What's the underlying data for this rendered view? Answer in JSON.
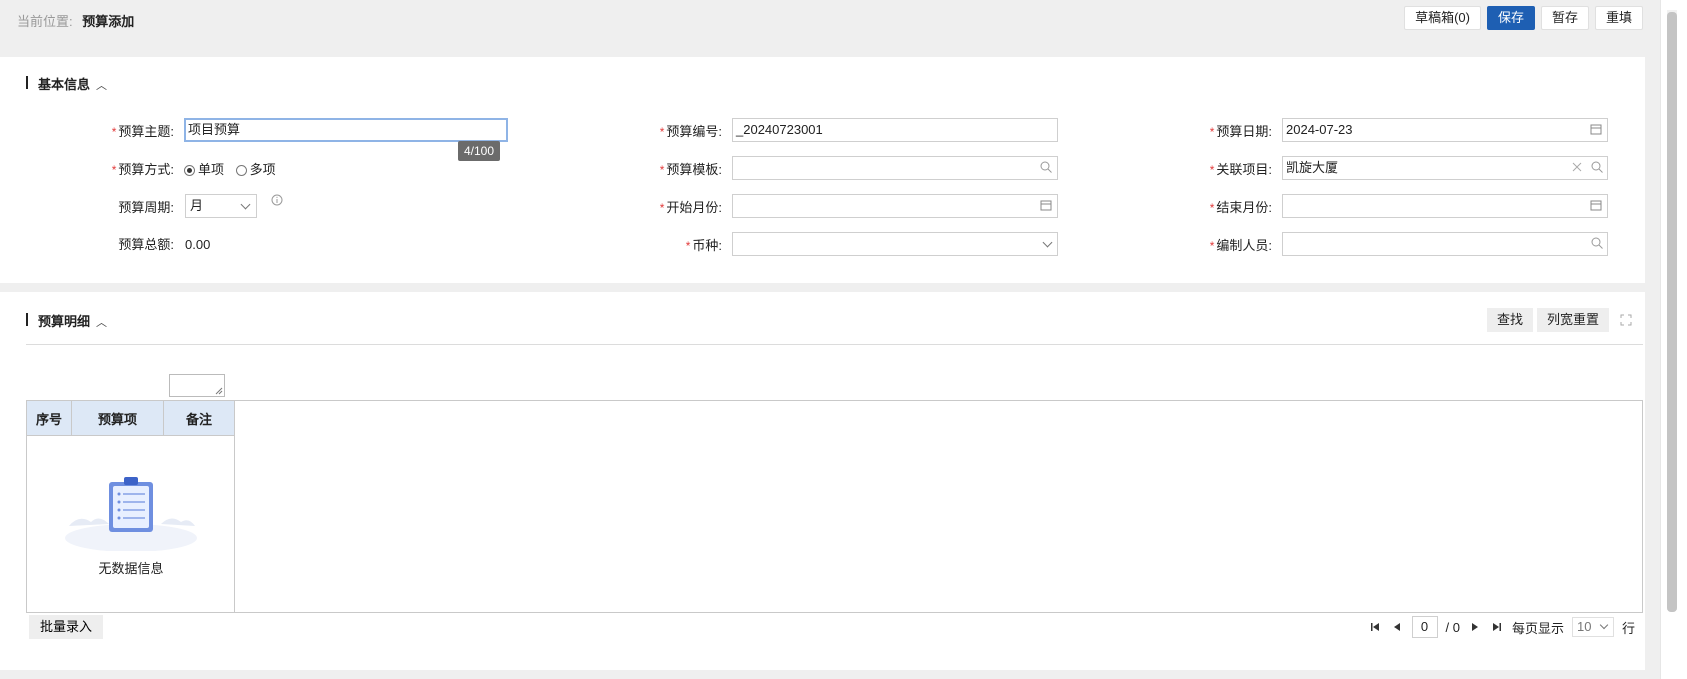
{
  "breadcrumb": {
    "label": "当前位置:",
    "current": "预算添加"
  },
  "toolbar": {
    "draft": "草稿箱(0)",
    "save": "保存",
    "temp_save": "暂存",
    "reset": "重填"
  },
  "basic": {
    "title": "基本信息",
    "subject": {
      "label": "预算主题:",
      "value": "项目预算",
      "counter": "4/100"
    },
    "number": {
      "label": "预算编号:",
      "value": "_20240723001"
    },
    "date": {
      "label": "预算日期:",
      "value": "2024-07-23"
    },
    "mode": {
      "label": "预算方式:",
      "options": [
        "单项",
        "多项"
      ],
      "selected": "单项"
    },
    "template": {
      "label": "预算模板:",
      "value": ""
    },
    "project": {
      "label": "关联项目:",
      "value": "凯旋大厦"
    },
    "period": {
      "label": "预算周期:",
      "value": "月"
    },
    "start_month": {
      "label": "开始月份:",
      "value": ""
    },
    "end_month": {
      "label": "结束月份:",
      "value": ""
    },
    "total": {
      "label": "预算总额:",
      "value": "0.00"
    },
    "currency": {
      "label": "币种:",
      "value": ""
    },
    "editor": {
      "label": "编制人员:",
      "value": ""
    }
  },
  "detail": {
    "title": "预算明细",
    "find": "查找",
    "reset_width": "列宽重置",
    "columns": [
      "序号",
      "预算项",
      "备注"
    ],
    "empty_text": "无数据信息",
    "batch_entry": "批量录入"
  },
  "pager": {
    "current": "0",
    "total": "/ 0",
    "per_page_label": "每页显示",
    "per_page": "10",
    "unit": "行"
  },
  "colors": {
    "primary": "#1e5fb3",
    "required": "#e23a3a",
    "header_bg": "#dde8f6"
  }
}
